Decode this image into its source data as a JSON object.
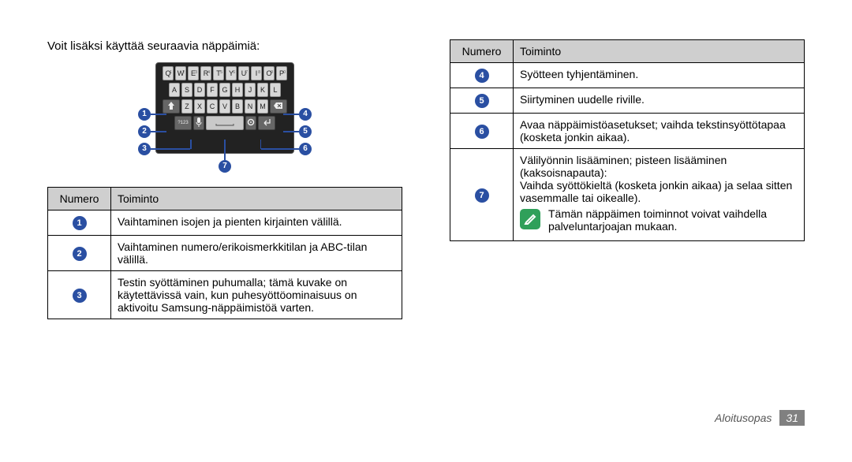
{
  "intro": "Voit lisäksi käyttää seuraavia näppäimiä:",
  "keyboard": {
    "row1": [
      {
        "k": "Q",
        "s": "1"
      },
      {
        "k": "W",
        "s": "2"
      },
      {
        "k": "E",
        "s": "3"
      },
      {
        "k": "R",
        "s": "4"
      },
      {
        "k": "T",
        "s": "5"
      },
      {
        "k": "Y",
        "s": "6"
      },
      {
        "k": "U",
        "s": "7"
      },
      {
        "k": "I",
        "s": "8"
      },
      {
        "k": "O",
        "s": "9"
      },
      {
        "k": "P",
        "s": "0"
      }
    ],
    "row2": [
      "A",
      "S",
      "D",
      "F",
      "G",
      "H",
      "J",
      "K",
      "L"
    ],
    "row3_mid": [
      "Z",
      "X",
      "C",
      "V",
      "B",
      "N",
      "M"
    ],
    "sym_label": "?123"
  },
  "callouts": {
    "1": "1",
    "2": "2",
    "3": "3",
    "4": "4",
    "5": "5",
    "6": "6",
    "7": "7"
  },
  "table_left": {
    "h_num": "Numero",
    "h_func": "Toiminto",
    "rows": [
      {
        "n": "1",
        "t": "Vaihtaminen isojen ja pienten kirjainten välillä."
      },
      {
        "n": "2",
        "t": "Vaihtaminen numero/erikoismerkkitilan ja ABC-tilan välillä."
      },
      {
        "n": "3",
        "t": "Testin syöttäminen puhumalla; tämä kuvake on käytettävissä vain, kun puhesyöttöominaisuus on aktivoitu Samsung-näppäimistöä varten."
      }
    ]
  },
  "table_right": {
    "h_num": "Numero",
    "h_func": "Toiminto",
    "rows": [
      {
        "n": "4",
        "t": "Syötteen tyhjentäminen."
      },
      {
        "n": "5",
        "t": "Siirtyminen uudelle riville."
      },
      {
        "n": "6",
        "t": "Avaa näppäimistöasetukset; vaihda tekstinsyöttötapaa (kosketa jonkin aikaa)."
      },
      {
        "n": "7",
        "t": "Välilyönnin lisääminen; pisteen lisääminen (kaksoisnapauta):\nVaihda syöttökieltä (kosketa jonkin aikaa) ja selaa sitten vasemmalle tai oikealle)."
      }
    ],
    "note": "Tämän näppäimen toiminnot voivat vaihdella palveluntarjoajan mukaan."
  },
  "footer": {
    "section": "Aloitusopas",
    "page": "31"
  }
}
